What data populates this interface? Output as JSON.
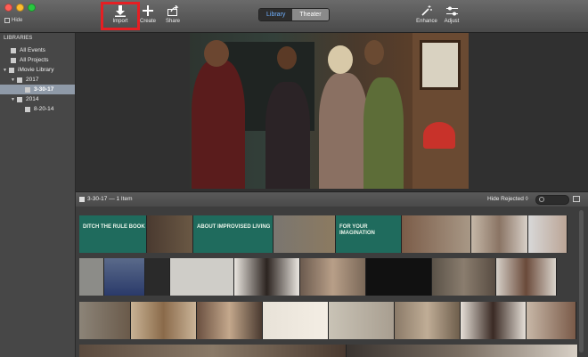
{
  "toolbar": {
    "hide_label": "Hide",
    "import_label": "Import",
    "create_label": "Create",
    "share_label": "Share",
    "library_tab": "Library",
    "theater_tab": "Theater",
    "enhance_label": "Enhance",
    "adjust_label": "Adjust"
  },
  "sidebar": {
    "header": "LIBRARIES",
    "items": [
      {
        "label": "All Events"
      },
      {
        "label": "All Projects"
      },
      {
        "label": "iMovie Library"
      },
      {
        "label": "2017"
      },
      {
        "label": "3-30-17"
      },
      {
        "label": "2014"
      },
      {
        "label": "8-20-14"
      }
    ]
  },
  "event": {
    "title": "3-30-17 — 1 Item",
    "filter": "Hide Rejected ◊"
  },
  "clips": {
    "row1_texts": [
      "DITCH THE RULE BOOK",
      "ABOUT IMPROVISED LIVING",
      "FOR YOUR IMAGINATION"
    ]
  },
  "colors": {
    "accent": "#6fb0ff",
    "highlight": "#e51f23",
    "selection": "#8f9aa8"
  }
}
